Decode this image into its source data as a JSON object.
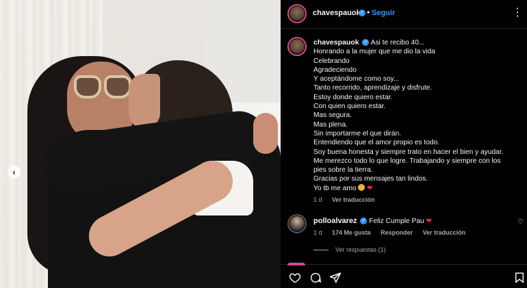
{
  "header": {
    "username": "chavespauok",
    "separator": "•",
    "follow_label": "Seguir",
    "more_label": "⋮"
  },
  "caption": {
    "username": "chavespauok",
    "lines": [
      "Asi te recibo 40...",
      "Honrando a la mujer que me dio la vida",
      "Celebrando",
      "Agradeciendo",
      "Y aceptándome como soy...",
      "Tanto recorrido, aprendizaje y disfrute.",
      "Estoy donde quiero estar.",
      "Con quien quiero estar.",
      "Mas segura.",
      "Mas plena.",
      "Sin importarme el que dirán.",
      "Entendiendo que el amor propio es todo.",
      "Soy buena honesta y siempre trato en hacer el bien y ayudar.",
      "Me merezco todo lo que logre. Trabajando y siempre con los",
      "pies sobre la tierra.",
      "Gracias por sus mensajes tan lindos.",
      "Yo tb me amo"
    ],
    "heart": "❤",
    "time": "1 d",
    "translate_label": "Ver traducción"
  },
  "comment": {
    "username": "polloalvarez",
    "text": "Feliz Cumple Pau",
    "heart": "❤",
    "time": "1 d",
    "likes": "174 Me gusta",
    "reply_label": "Responder",
    "translate_label": "Ver traducción",
    "view_replies": "Ver respuestas (1)"
  },
  "carousel": {
    "prev_label": "‹"
  },
  "colors": {
    "accent": "#3897f0",
    "heart": "#ed2b3e",
    "muted": "#a8a8a8"
  },
  "icons": [
    "like-icon",
    "comment-icon",
    "share-icon",
    "save-icon",
    "verified-icon",
    "more-icon"
  ]
}
